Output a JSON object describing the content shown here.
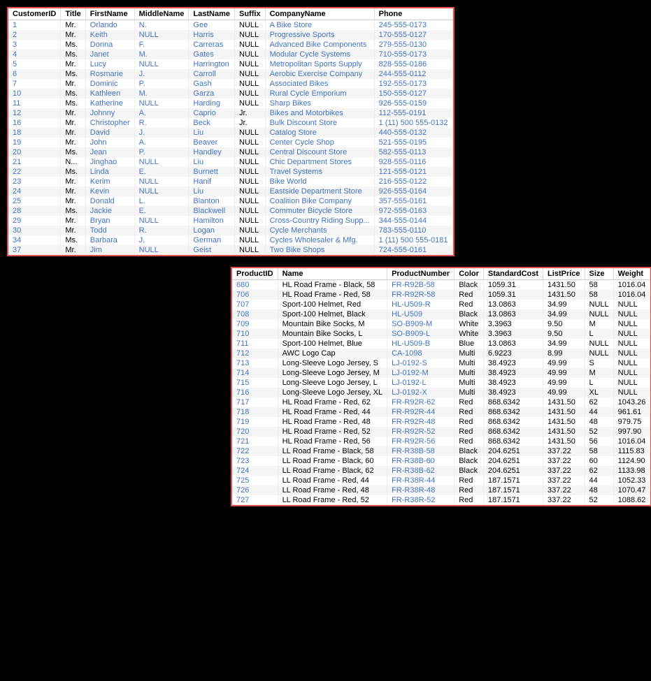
{
  "topTable": {
    "columns": [
      "CustomerID",
      "Title",
      "FirstName",
      "MiddleName",
      "LastName",
      "Suffix",
      "CompanyName",
      "Phone"
    ],
    "rows": [
      [
        "1",
        "Mr.",
        "Orlando",
        "N.",
        "Gee",
        "NULL",
        "A Bike Store",
        "245-555-0173"
      ],
      [
        "2",
        "Mr.",
        "Keith",
        "NULL",
        "Harris",
        "NULL",
        "Progressive Sports",
        "170-555-0127"
      ],
      [
        "3",
        "Ms.",
        "Donna",
        "F.",
        "Carreras",
        "NULL",
        "Advanced Bike Components",
        "279-555-0130"
      ],
      [
        "4",
        "Ms.",
        "Janet",
        "M.",
        "Gates",
        "NULL",
        "Modular Cycle Systems",
        "710-555-0173"
      ],
      [
        "5",
        "Mr.",
        "Lucy",
        "NULL",
        "Harrington",
        "NULL",
        "Metropolitan Sports Supply",
        "828-555-0186"
      ],
      [
        "6",
        "Ms.",
        "Rosmarie",
        "J.",
        "Carroll",
        "NULL",
        "Aerobic Exercise Company",
        "244-555-0112"
      ],
      [
        "7",
        "Mr.",
        "Dominic",
        "P.",
        "Gash",
        "NULL",
        "Associated Bikes",
        "192-555-0173"
      ],
      [
        "10",
        "Ms.",
        "Kathleen",
        "M.",
        "Garza",
        "NULL",
        "Rural Cycle Emporium",
        "150-555-0127"
      ],
      [
        "11",
        "Ms.",
        "Katherine",
        "NULL",
        "Harding",
        "NULL",
        "Sharp Bikes",
        "926-555-0159"
      ],
      [
        "12",
        "Mr.",
        "Johnny",
        "A.",
        "Caprio",
        "Jr.",
        "Bikes and Motorbikes",
        "112-555-0191"
      ],
      [
        "16",
        "Mr.",
        "Christopher",
        "R.",
        "Beck",
        "Jr.",
        "Bulk Discount Store",
        "1 (11) 500 555-0132"
      ],
      [
        "18",
        "Mr.",
        "David",
        "J.",
        "Liu",
        "NULL",
        "Catalog Store",
        "440-555-0132"
      ],
      [
        "19",
        "Mr.",
        "John",
        "A.",
        "Beaver",
        "NULL",
        "Center Cycle Shop",
        "521-555-0195"
      ],
      [
        "20",
        "Ms.",
        "Jean",
        "P.",
        "Handley",
        "NULL",
        "Central Discount Store",
        "582-555-0113"
      ],
      [
        "21",
        "N...",
        "Jinghao",
        "NULL",
        "Liu",
        "NULL",
        "Chic Department Stores",
        "928-555-0116"
      ],
      [
        "22",
        "Ms.",
        "Linda",
        "E.",
        "Burnett",
        "NULL",
        "Travel Systems",
        "121-555-0121"
      ],
      [
        "23",
        "Mr.",
        "Kerim",
        "NULL",
        "Hanif",
        "NULL",
        "Bike World",
        "216-555-0122"
      ],
      [
        "24",
        "Mr.",
        "Kevin",
        "NULL",
        "Liu",
        "NULL",
        "Eastside Department Store",
        "926-555-0164"
      ],
      [
        "25",
        "Mr.",
        "Donald",
        "L.",
        "Blanton",
        "NULL",
        "Coalition Bike Company",
        "357-555-0161"
      ],
      [
        "28",
        "Ms.",
        "Jackie",
        "E.",
        "Blackwell",
        "NULL",
        "Commuter Bicycle Store",
        "972-555-0163"
      ],
      [
        "29",
        "Mr.",
        "Bryan",
        "NULL",
        "Hamilton",
        "NULL",
        "Cross-Country Riding Supp...",
        "344-555-0144"
      ],
      [
        "30",
        "Mr.",
        "Todd",
        "R.",
        "Logan",
        "NULL",
        "Cycle Merchants",
        "783-555-0110"
      ],
      [
        "34",
        "Ms.",
        "Barbara",
        "J.",
        "German",
        "NULL",
        "Cycles Wholesaler & Mfg.",
        "1 (11) 500 555-0181"
      ],
      [
        "37",
        "Mr.",
        "Jim",
        "NULL",
        "Geist",
        "NULL",
        "Two Bike Shops",
        "724-555-0161"
      ]
    ]
  },
  "bottomTable": {
    "columns": [
      "ProductID",
      "Name",
      "ProductNumber",
      "Color",
      "StandardCost",
      "ListPrice",
      "Size",
      "Weight"
    ],
    "rows": [
      [
        "680",
        "HL Road Frame - Black, 58",
        "FR-R92B-58",
        "Black",
        "1059.31",
        "1431.50",
        "58",
        "1016.04"
      ],
      [
        "706",
        "HL Road Frame - Red, 58",
        "FR-R92R-58",
        "Red",
        "1059.31",
        "1431.50",
        "58",
        "1016.04"
      ],
      [
        "707",
        "Sport-100 Helmet, Red",
        "HL-U509-R",
        "Red",
        "13.0863",
        "34.99",
        "NULL",
        "NULL"
      ],
      [
        "708",
        "Sport-100 Helmet, Black",
        "HL-U509",
        "Black",
        "13.0863",
        "34.99",
        "NULL",
        "NULL"
      ],
      [
        "709",
        "Mountain Bike Socks, M",
        "SO-B909-M",
        "White",
        "3.3963",
        "9.50",
        "M",
        "NULL"
      ],
      [
        "710",
        "Mountain Bike Socks, L",
        "SO-B909-L",
        "White",
        "3.3963",
        "9.50",
        "L",
        "NULL"
      ],
      [
        "711",
        "Sport-100 Helmet, Blue",
        "HL-U509-B",
        "Blue",
        "13.0863",
        "34.99",
        "NULL",
        "NULL"
      ],
      [
        "712",
        "AWC Logo Cap",
        "CA-1098",
        "Multi",
        "6.9223",
        "8.99",
        "NULL",
        "NULL"
      ],
      [
        "713",
        "Long-Sleeve Logo Jersey, S",
        "LJ-0192-S",
        "Multi",
        "38.4923",
        "49.99",
        "S",
        "NULL"
      ],
      [
        "714",
        "Long-Sleeve Logo Jersey, M",
        "LJ-0192-M",
        "Multi",
        "38.4923",
        "49.99",
        "M",
        "NULL"
      ],
      [
        "715",
        "Long-Sleeve Logo Jersey, L",
        "LJ-0192-L",
        "Multi",
        "38.4923",
        "49.99",
        "L",
        "NULL"
      ],
      [
        "716",
        "Long-Sleeve Logo Jersey, XL",
        "LJ-0192-X",
        "Multi",
        "38.4923",
        "49.99",
        "XL",
        "NULL"
      ],
      [
        "717",
        "HL Road Frame - Red, 62",
        "FR-R92R-62",
        "Red",
        "868.6342",
        "1431.50",
        "62",
        "1043.26"
      ],
      [
        "718",
        "HL Road Frame - Red, 44",
        "FR-R92R-44",
        "Red",
        "868.6342",
        "1431.50",
        "44",
        "961.61"
      ],
      [
        "719",
        "HL Road Frame - Red, 48",
        "FR-R92R-48",
        "Red",
        "868.6342",
        "1431.50",
        "48",
        "979.75"
      ],
      [
        "720",
        "HL Road Frame - Red, 52",
        "FR-R92R-52",
        "Red",
        "868.6342",
        "1431.50",
        "52",
        "997.90"
      ],
      [
        "721",
        "HL Road Frame - Red, 56",
        "FR-R92R-56",
        "Red",
        "868.6342",
        "1431.50",
        "56",
        "1016.04"
      ],
      [
        "722",
        "LL Road Frame - Black, 58",
        "FR-R38B-58",
        "Black",
        "204.6251",
        "337.22",
        "58",
        "1115.83"
      ],
      [
        "723",
        "LL Road Frame - Black, 60",
        "FR-R38B-60",
        "Black",
        "204.6251",
        "337.22",
        "60",
        "1124.90"
      ],
      [
        "724",
        "LL Road Frame - Black, 62",
        "FR-R38B-62",
        "Black",
        "204.6251",
        "337.22",
        "62",
        "1133.98"
      ],
      [
        "725",
        "LL Road Frame - Red, 44",
        "FR-R38R-44",
        "Red",
        "187.1571",
        "337.22",
        "44",
        "1052.33"
      ],
      [
        "726",
        "LL Road Frame - Red, 48",
        "FR-R38R-48",
        "Red",
        "187.1571",
        "337.22",
        "48",
        "1070.47"
      ],
      [
        "727",
        "LL Road Frame - Red, 52",
        "FR-R38R-52",
        "Red",
        "187.1571",
        "337.22",
        "52",
        "1088.62"
      ]
    ]
  }
}
